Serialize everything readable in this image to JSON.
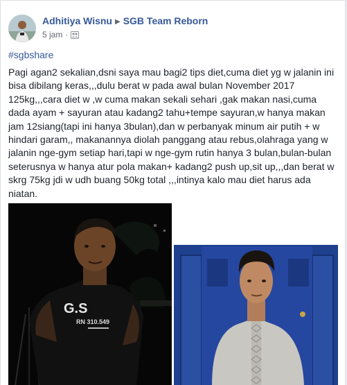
{
  "post": {
    "author": "Adhitiya Wisnu",
    "group": "SGB Team Reborn",
    "time": "5 jam",
    "hashtag": "#sgbshare",
    "body": "Pagi agan2 sekalian,dsni saya mau bagi2 tips diet,cuma diet yg w jalanin ini\nbisa dibilang keras,,,dulu berat w pada awal bulan November 2017\n125kg,,,cara diet w ,w cuma makan sekali sehari ,gak makan nasi,cuma\ndada ayam + sayuran atau kadang2 tahu+tempe sayuran,w hanya makan\njam 12siang(tapi ini hanya 3bulan),dan w perbanyak minum air putih + w\nhindari garam,, makanannya diolah panggang atau rebus,olahraga yang w\njalanin nge-gym setiap hari,tapi w nge-gym rutin hanya 3 bulan,bulan-bulan\nseterusnya w hanya atur pola makan+ kadang2 push up,sit up,,,dan berat w\nskrg 75kg jdi w udh buang 50kg total ,,,intinya kalo mau diet harus ada\nniatan."
  },
  "photos": {
    "before_shirt_line1": "G.S",
    "before_shirt_line2": "RN 310.549"
  },
  "colors": {
    "link": "#365899",
    "text": "#1d2129",
    "meta": "#616770"
  }
}
